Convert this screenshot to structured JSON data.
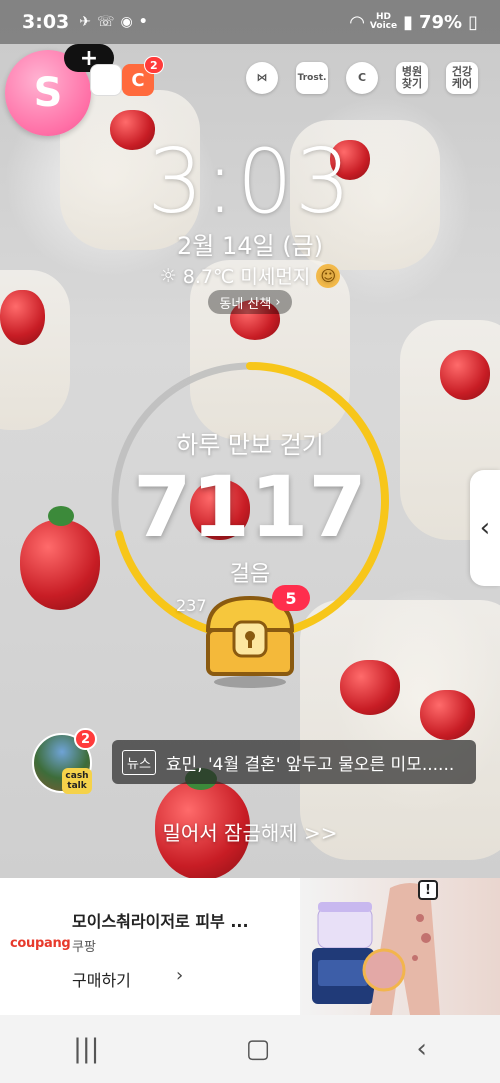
{
  "status_bar": {
    "time": "3:03",
    "network": "HD",
    "network_sub": "Voice",
    "battery": "79%"
  },
  "top_apps": {
    "avatar_letter": "S",
    "add_label": "+",
    "app_badge": "2",
    "icon_trost": "Trost.",
    "icon_hospital": "병원\n찾기",
    "icon_health": "건강\n케어"
  },
  "lockscreen": {
    "clock": "3:03",
    "date": "2월 14일 (금)",
    "weather": "8.7℃ 미세먼지",
    "walk_label": "동네 산책"
  },
  "steps": {
    "title": "하루 만보 걷기",
    "count": "7117",
    "unit": "걸음",
    "sub_prefix": "237",
    "progress": 0.71,
    "chest_badge": "5"
  },
  "cash_talk": {
    "badge": "2",
    "label": "cash talk"
  },
  "news": {
    "tag": "뉴스",
    "title": "효민, '4월 결혼' 앞두고 물오른 미모......"
  },
  "unlock_text": "밀어서 잠금해제 >>",
  "ad": {
    "logo_main": "coupang",
    "title": "모이스춰라이저로 피부 ...",
    "source": "쿠팡",
    "cta": "구매하기",
    "warning": "!"
  },
  "colors": {
    "ring_progress": "#f7c61a",
    "ring_track": "#bdbdbd",
    "badge_red": "#ff3b3b",
    "avatar_pink": "#ff6fa6"
  }
}
